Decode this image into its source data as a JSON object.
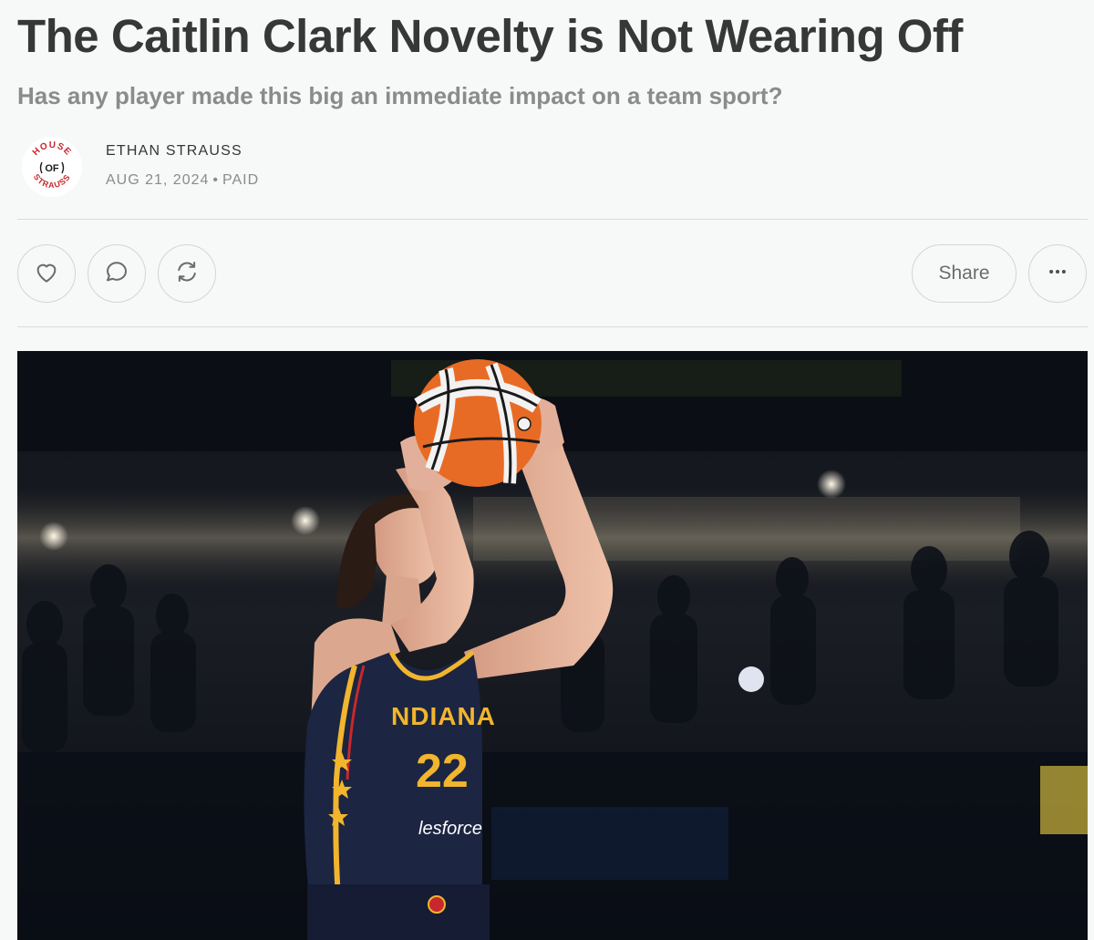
{
  "post": {
    "title": "The Caitlin Clark Novelty is Not Wearing Off",
    "subtitle": "Has any player made this big an immediate impact on a team sport?",
    "author": "ETHAN STRAUSS",
    "date": "AUG 21, 2024",
    "separator": "•",
    "access": "PAID"
  },
  "publication": {
    "logo_text_top": "HOUSE",
    "logo_text_mid": "OF",
    "logo_text_bottom": "STRAUSS",
    "logo_color": "#c8282d"
  },
  "actions": {
    "share_label": "Share",
    "like_icon": "heart-icon",
    "comment_icon": "comment-icon",
    "restack_icon": "restack-icon",
    "more_icon": "more-icon"
  },
  "hero_image": {
    "jersey_text": "NDIANA",
    "jersey_number": "22",
    "sponsor_text": "lesforce",
    "colors": {
      "jersey": "#1c2541",
      "gold": "#f1b52e",
      "ball": "#e86b25"
    }
  }
}
